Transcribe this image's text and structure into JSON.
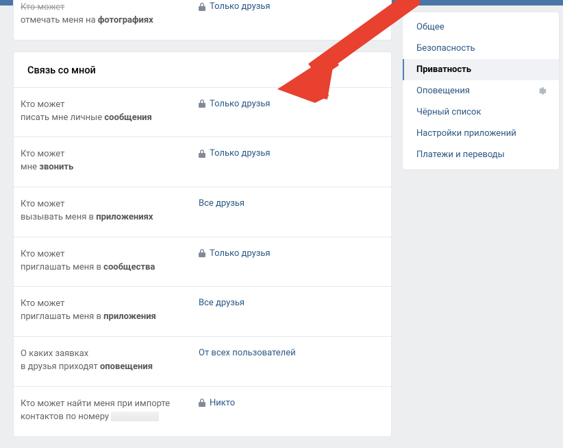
{
  "top_card": {
    "row0": {
      "label_line1": "Кто может",
      "label_line2_plain": "отмечать меня на ",
      "label_line2_bold": "фотографиях",
      "value": "Только друзья",
      "locked": true
    }
  },
  "contact_section": {
    "header": "Связь со мной",
    "rows": [
      {
        "l1": "Кто может",
        "l2p": "писать мне личные ",
        "l2b": "сообщения",
        "value": "Только друзья",
        "locked": true
      },
      {
        "l1": "Кто может",
        "l2p": "мне ",
        "l2b": "звонить",
        "value": "Только друзья",
        "locked": true
      },
      {
        "l1": "Кто может",
        "l2p": "вызывать меня в ",
        "l2b": "приложениях",
        "value": "Все друзья",
        "locked": false
      },
      {
        "l1": "Кто может",
        "l2p": "приглашать меня в ",
        "l2b": "сообщества",
        "value": "Только друзья",
        "locked": true
      },
      {
        "l1": "Кто может",
        "l2p": "приглашать меня в ",
        "l2b": "приложения",
        "value": "Все друзья",
        "locked": false
      },
      {
        "l1": "О каких заявках",
        "l2p": "в друзья приходят ",
        "l2b": "оповещения",
        "value": "От всех пользователей",
        "locked": false
      },
      {
        "l1": "Кто может найти меня при импорте",
        "l2p": "контактов по номеру ",
        "l2b": "",
        "value": "Никто",
        "locked": true,
        "censored": true
      }
    ]
  },
  "sidebar": {
    "items": [
      {
        "label": "Общее"
      },
      {
        "label": "Безопасность"
      },
      {
        "label": "Приватность"
      },
      {
        "label": "Оповещения"
      },
      {
        "label": "Чёрный список"
      },
      {
        "label": "Настройки приложений"
      },
      {
        "label": "Платежи и переводы"
      }
    ],
    "active_index": 2,
    "gear_index": 3
  },
  "colors": {
    "arrow": "#e8412f"
  }
}
